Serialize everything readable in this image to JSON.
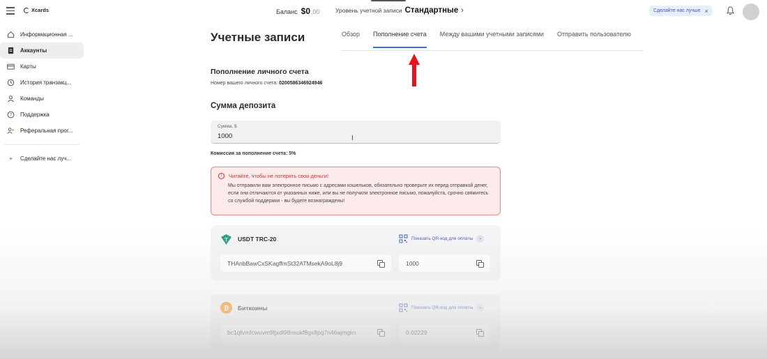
{
  "header": {
    "logo_text": "Xcards",
    "balance_label": "Баланс",
    "balance_value": "$0",
    "balance_cents": ".00",
    "level_label": "Уровень учетной записи",
    "level_value": "Стандартные",
    "promo_label": "Сделайте нас лучше"
  },
  "sidebar": {
    "items": [
      {
        "label": "Информационная ...",
        "icon": "home-icon"
      },
      {
        "label": "Аккаунты",
        "icon": "document-icon"
      },
      {
        "label": "Карты",
        "icon": "card-icon"
      },
      {
        "label": "История транзакц...",
        "icon": "history-icon"
      },
      {
        "label": "Команды",
        "icon": "team-icon"
      },
      {
        "label": "Поддержка",
        "icon": "help-icon"
      },
      {
        "label": "Реферальная прог...",
        "icon": "referral-icon"
      }
    ],
    "feedback": "Сделайте нас луч..."
  },
  "main": {
    "title": "Учетные записи",
    "tabs": [
      {
        "label": "Обзор"
      },
      {
        "label": "Пополнение счета"
      },
      {
        "label": "Между вашими учетными записями"
      },
      {
        "label": "Отправить пользователю"
      }
    ],
    "section_title": "Пополнение личного счета",
    "account_label": "Номер вашего личного счета:",
    "account_number": "0200586346924946",
    "deposit_title": "Сумма депозита",
    "amount_label": "Сумма, $",
    "amount_value": "1000",
    "fee_text": "Комиссия за пополнение счета: 5%",
    "warning_title": "Читайте, чтобы не потерять свои деньги!",
    "warning_body": "Мы отправили вам электронное письмо с адресами кошельков, обязательно проверьте их перед отправкой денег, если они отличаются от указанных ниже, или вы не получили электронное письмо, пожалуйста, срочно свяжитесь со службой поддержки - вы будете вознаграждены!",
    "cards": [
      {
        "name": "USDT TRC-20",
        "qr_label": "Показать QR-код для оплаты",
        "address": "THAnbBawCxSKagffmSt32ATMsekA9oL8j9",
        "amount": "1000",
        "color": "#26a17b"
      },
      {
        "name": "Биткоины",
        "qr_label": "Показать QR-код для оплаты",
        "address": "bc1qfvmfcwuvm9fjxdl98nsukf8gx8pq7n46ajmgkn",
        "amount": "0.02229",
        "color": "#f7931a"
      }
    ]
  },
  "colors": {
    "accent": "#3c6fd1",
    "warning_bg": "#fdeaea",
    "warning_border": "#e28a8a",
    "arrow": "#e8141b"
  }
}
